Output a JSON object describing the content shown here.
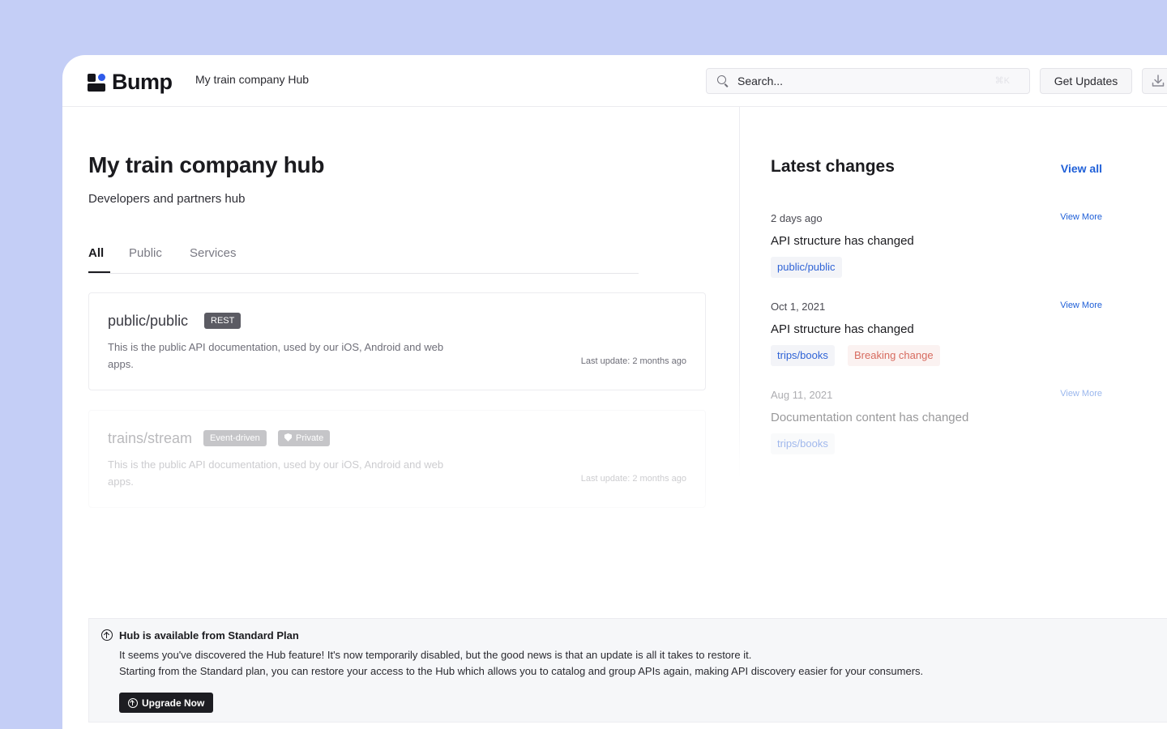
{
  "header": {
    "brand": "Bump",
    "hub_name": "My train company Hub",
    "search_placeholder": "Search...",
    "search_shortcut": "⌘K",
    "get_updates_label": "Get Updates",
    "download_icon": "download-icon"
  },
  "hub": {
    "title": "My train company hub",
    "subtitle": "Developers and partners hub",
    "tabs": [
      {
        "label": "All",
        "active": true
      },
      {
        "label": "Public",
        "active": false
      },
      {
        "label": "Services",
        "active": false
      }
    ],
    "apis": [
      {
        "name": "public/public",
        "badges": [
          "REST"
        ],
        "description": "This is the public API documentation, used by our iOS, Android and web apps.",
        "last_update": "Last update: 2 months ago"
      },
      {
        "name": "trains/stream",
        "badges": [
          "Event-driven",
          "Private"
        ],
        "description": "This is the public API documentation, used by our iOS, Android and web apps.",
        "last_update": "Last update: 2 months ago"
      }
    ]
  },
  "latest_changes": {
    "title": "Latest changes",
    "view_all_label": "View all",
    "items": [
      {
        "date": "2 days ago",
        "view_more": "View More",
        "title": "API structure has changed",
        "tags": [
          "public/public"
        ]
      },
      {
        "date": "Oct 1, 2021",
        "view_more": "View More",
        "title": "API structure has changed",
        "tags": [
          "trips/books",
          "Breaking change"
        ]
      },
      {
        "date": "Aug 11, 2021",
        "view_more": "View More",
        "title": "Documentation content has changed",
        "tags": [
          "trips/books"
        ]
      }
    ]
  },
  "banner": {
    "title": "Hub is available from Standard Plan",
    "line1": "It seems you've discovered the Hub feature! It's now temporarily disabled, but the good news is that an update is all it takes to restore it.",
    "line2": "Starting from the Standard plan, you can restore your access to the Hub which allows you to catalog and group APIs again, making API discovery easier for your consumers.",
    "upgrade_label": "Upgrade Now"
  },
  "colors": {
    "background": "#c4cef6",
    "accent": "#2060d8",
    "brand_dot": "#2f5bea",
    "danger": "#d76b5f"
  }
}
